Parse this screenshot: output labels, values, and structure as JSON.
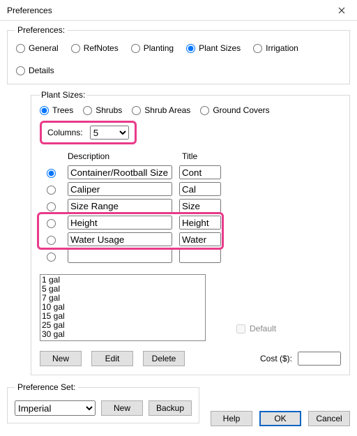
{
  "window": {
    "title": "Preferences"
  },
  "tabs": {
    "legend": "Preferences:",
    "items": [
      "General",
      "RefNotes",
      "Planting",
      "Plant Sizes",
      "Irrigation",
      "Details"
    ],
    "selected": "Plant Sizes"
  },
  "plant_sizes": {
    "legend": "Plant Sizes:",
    "types": [
      "Trees",
      "Shrubs",
      "Shrub Areas",
      "Ground Covers"
    ],
    "type_selected": "Trees",
    "columns_label": "Columns:",
    "columns_value": "5",
    "headers": {
      "description": "Description",
      "title": "Title"
    },
    "rows": [
      {
        "selected": true,
        "description": "Container/Rootball Size",
        "title": "Cont"
      },
      {
        "selected": false,
        "description": "Caliper",
        "title": "Cal"
      },
      {
        "selected": false,
        "description": "Size Range",
        "title": "Size"
      },
      {
        "selected": false,
        "description": "Height",
        "title": "Height"
      },
      {
        "selected": false,
        "description": "Water Usage",
        "title": "Water"
      },
      {
        "selected": false,
        "description": "",
        "title": ""
      }
    ],
    "sizes_list": [
      "1 gal",
      "5 gal",
      "7 gal",
      "10 gal",
      "15 gal",
      "25 gal",
      "30 gal"
    ],
    "buttons": {
      "new": "New",
      "edit": "Edit",
      "delete": "Delete"
    },
    "default_label": "Default",
    "cost_label": "Cost ($):",
    "cost_value": ""
  },
  "preference_set": {
    "legend": "Preference Set:",
    "value": "Imperial",
    "new": "New",
    "backup": "Backup"
  },
  "dialog_buttons": {
    "help": "Help",
    "ok": "OK",
    "cancel": "Cancel"
  }
}
